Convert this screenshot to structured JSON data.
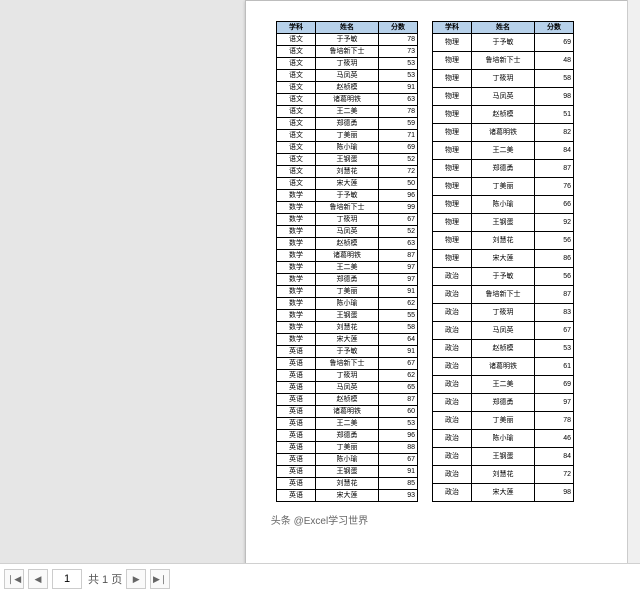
{
  "pagebar": {
    "first_label": "❘◀",
    "prev_label": "◀",
    "current_page": "1",
    "total_text": "共 1 页",
    "next_label": "▶",
    "last_label": "▶❘"
  },
  "watermark": "头条 @Excel学习世界",
  "headers": {
    "subject": "学科",
    "name": "姓名",
    "score": "分数"
  },
  "left_rows": [
    [
      "语文",
      "于予敏",
      78
    ],
    [
      "语文",
      "鲁培新下士",
      73
    ],
    [
      "语文",
      "丁筱玥",
      53
    ],
    [
      "语文",
      "马凤英",
      53
    ],
    [
      "语文",
      "赵桢模",
      91
    ],
    [
      "语文",
      "诸葛明铁",
      63
    ],
    [
      "语文",
      "王二美",
      78
    ],
    [
      "语文",
      "郑德勇",
      59
    ],
    [
      "语文",
      "丁美丽",
      71
    ],
    [
      "语文",
      "陈小瑜",
      69
    ],
    [
      "语文",
      "王钢蛋",
      52
    ],
    [
      "语文",
      "刘慧花",
      72
    ],
    [
      "语文",
      "宋大莲",
      50
    ],
    [
      "数学",
      "于予敏",
      96
    ],
    [
      "数学",
      "鲁培新下士",
      99
    ],
    [
      "数学",
      "丁筱玥",
      67
    ],
    [
      "数学",
      "马凤英",
      52
    ],
    [
      "数学",
      "赵桢模",
      63
    ],
    [
      "数学",
      "诸葛明铁",
      87
    ],
    [
      "数学",
      "王二美",
      97
    ],
    [
      "数学",
      "郑德勇",
      97
    ],
    [
      "数学",
      "丁美丽",
      91
    ],
    [
      "数学",
      "陈小瑜",
      62
    ],
    [
      "数学",
      "王钢蛋",
      55
    ],
    [
      "数学",
      "刘慧花",
      58
    ],
    [
      "数学",
      "宋大莲",
      64
    ],
    [
      "英语",
      "于予敏",
      91
    ],
    [
      "英语",
      "鲁培新下士",
      67
    ],
    [
      "英语",
      "丁筱玥",
      62
    ],
    [
      "英语",
      "马凤英",
      65
    ],
    [
      "英语",
      "赵桢模",
      87
    ],
    [
      "英语",
      "诸葛明铁",
      60
    ],
    [
      "英语",
      "王二美",
      53
    ],
    [
      "英语",
      "郑德勇",
      96
    ],
    [
      "英语",
      "丁美丽",
      88
    ],
    [
      "英语",
      "陈小瑜",
      67
    ],
    [
      "英语",
      "王钢蛋",
      91
    ],
    [
      "英语",
      "刘慧花",
      85
    ],
    [
      "英语",
      "宋大莲",
      93
    ]
  ],
  "right_rows": [
    [
      "物理",
      "于予敏",
      69
    ],
    [
      "物理",
      "鲁培新下士",
      48
    ],
    [
      "物理",
      "丁筱玥",
      58
    ],
    [
      "物理",
      "马凤英",
      98
    ],
    [
      "物理",
      "赵桢模",
      51
    ],
    [
      "物理",
      "诸葛明铁",
      82
    ],
    [
      "物理",
      "王二美",
      84
    ],
    [
      "物理",
      "郑德勇",
      87
    ],
    [
      "物理",
      "丁美丽",
      76
    ],
    [
      "物理",
      "陈小瑜",
      66
    ],
    [
      "物理",
      "王钢蛋",
      92
    ],
    [
      "物理",
      "刘慧花",
      56
    ],
    [
      "物理",
      "宋大莲",
      86
    ],
    [
      "政治",
      "于予敏",
      56
    ],
    [
      "政治",
      "鲁培新下士",
      87
    ],
    [
      "政治",
      "丁筱玥",
      83
    ],
    [
      "政治",
      "马凤英",
      67
    ],
    [
      "政治",
      "赵桢模",
      53
    ],
    [
      "政治",
      "诸葛明铁",
      61
    ],
    [
      "政治",
      "王二美",
      69
    ],
    [
      "政治",
      "郑德勇",
      97
    ],
    [
      "政治",
      "丁美丽",
      78
    ],
    [
      "政治",
      "陈小瑜",
      46
    ],
    [
      "政治",
      "王钢蛋",
      84
    ],
    [
      "政治",
      "刘慧花",
      72
    ],
    [
      "政治",
      "宋大莲",
      98
    ]
  ]
}
